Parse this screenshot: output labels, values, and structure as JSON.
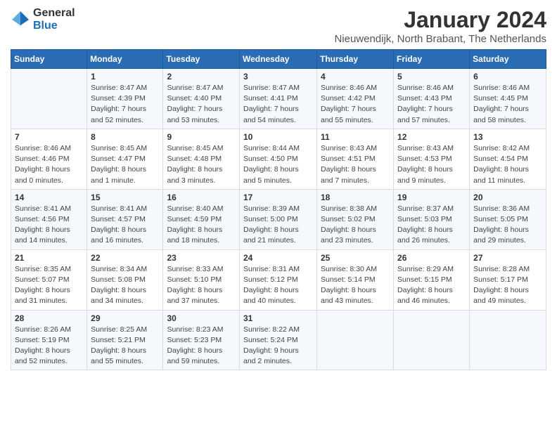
{
  "header": {
    "logo_general": "General",
    "logo_blue": "Blue",
    "title": "January 2024",
    "location": "Nieuwendijk, North Brabant, The Netherlands"
  },
  "weekdays": [
    "Sunday",
    "Monday",
    "Tuesday",
    "Wednesday",
    "Thursday",
    "Friday",
    "Saturday"
  ],
  "weeks": [
    [
      {
        "day": "",
        "info": ""
      },
      {
        "day": "1",
        "info": "Sunrise: 8:47 AM\nSunset: 4:39 PM\nDaylight: 7 hours\nand 52 minutes."
      },
      {
        "day": "2",
        "info": "Sunrise: 8:47 AM\nSunset: 4:40 PM\nDaylight: 7 hours\nand 53 minutes."
      },
      {
        "day": "3",
        "info": "Sunrise: 8:47 AM\nSunset: 4:41 PM\nDaylight: 7 hours\nand 54 minutes."
      },
      {
        "day": "4",
        "info": "Sunrise: 8:46 AM\nSunset: 4:42 PM\nDaylight: 7 hours\nand 55 minutes."
      },
      {
        "day": "5",
        "info": "Sunrise: 8:46 AM\nSunset: 4:43 PM\nDaylight: 7 hours\nand 57 minutes."
      },
      {
        "day": "6",
        "info": "Sunrise: 8:46 AM\nSunset: 4:45 PM\nDaylight: 7 hours\nand 58 minutes."
      }
    ],
    [
      {
        "day": "7",
        "info": "Sunrise: 8:46 AM\nSunset: 4:46 PM\nDaylight: 8 hours\nand 0 minutes."
      },
      {
        "day": "8",
        "info": "Sunrise: 8:45 AM\nSunset: 4:47 PM\nDaylight: 8 hours\nand 1 minute."
      },
      {
        "day": "9",
        "info": "Sunrise: 8:45 AM\nSunset: 4:48 PM\nDaylight: 8 hours\nand 3 minutes."
      },
      {
        "day": "10",
        "info": "Sunrise: 8:44 AM\nSunset: 4:50 PM\nDaylight: 8 hours\nand 5 minutes."
      },
      {
        "day": "11",
        "info": "Sunrise: 8:43 AM\nSunset: 4:51 PM\nDaylight: 8 hours\nand 7 minutes."
      },
      {
        "day": "12",
        "info": "Sunrise: 8:43 AM\nSunset: 4:53 PM\nDaylight: 8 hours\nand 9 minutes."
      },
      {
        "day": "13",
        "info": "Sunrise: 8:42 AM\nSunset: 4:54 PM\nDaylight: 8 hours\nand 11 minutes."
      }
    ],
    [
      {
        "day": "14",
        "info": "Sunrise: 8:41 AM\nSunset: 4:56 PM\nDaylight: 8 hours\nand 14 minutes."
      },
      {
        "day": "15",
        "info": "Sunrise: 8:41 AM\nSunset: 4:57 PM\nDaylight: 8 hours\nand 16 minutes."
      },
      {
        "day": "16",
        "info": "Sunrise: 8:40 AM\nSunset: 4:59 PM\nDaylight: 8 hours\nand 18 minutes."
      },
      {
        "day": "17",
        "info": "Sunrise: 8:39 AM\nSunset: 5:00 PM\nDaylight: 8 hours\nand 21 minutes."
      },
      {
        "day": "18",
        "info": "Sunrise: 8:38 AM\nSunset: 5:02 PM\nDaylight: 8 hours\nand 23 minutes."
      },
      {
        "day": "19",
        "info": "Sunrise: 8:37 AM\nSunset: 5:03 PM\nDaylight: 8 hours\nand 26 minutes."
      },
      {
        "day": "20",
        "info": "Sunrise: 8:36 AM\nSunset: 5:05 PM\nDaylight: 8 hours\nand 29 minutes."
      }
    ],
    [
      {
        "day": "21",
        "info": "Sunrise: 8:35 AM\nSunset: 5:07 PM\nDaylight: 8 hours\nand 31 minutes."
      },
      {
        "day": "22",
        "info": "Sunrise: 8:34 AM\nSunset: 5:08 PM\nDaylight: 8 hours\nand 34 minutes."
      },
      {
        "day": "23",
        "info": "Sunrise: 8:33 AM\nSunset: 5:10 PM\nDaylight: 8 hours\nand 37 minutes."
      },
      {
        "day": "24",
        "info": "Sunrise: 8:31 AM\nSunset: 5:12 PM\nDaylight: 8 hours\nand 40 minutes."
      },
      {
        "day": "25",
        "info": "Sunrise: 8:30 AM\nSunset: 5:14 PM\nDaylight: 8 hours\nand 43 minutes."
      },
      {
        "day": "26",
        "info": "Sunrise: 8:29 AM\nSunset: 5:15 PM\nDaylight: 8 hours\nand 46 minutes."
      },
      {
        "day": "27",
        "info": "Sunrise: 8:28 AM\nSunset: 5:17 PM\nDaylight: 8 hours\nand 49 minutes."
      }
    ],
    [
      {
        "day": "28",
        "info": "Sunrise: 8:26 AM\nSunset: 5:19 PM\nDaylight: 8 hours\nand 52 minutes."
      },
      {
        "day": "29",
        "info": "Sunrise: 8:25 AM\nSunset: 5:21 PM\nDaylight: 8 hours\nand 55 minutes."
      },
      {
        "day": "30",
        "info": "Sunrise: 8:23 AM\nSunset: 5:23 PM\nDaylight: 8 hours\nand 59 minutes."
      },
      {
        "day": "31",
        "info": "Sunrise: 8:22 AM\nSunset: 5:24 PM\nDaylight: 9 hours\nand 2 minutes."
      },
      {
        "day": "",
        "info": ""
      },
      {
        "day": "",
        "info": ""
      },
      {
        "day": "",
        "info": ""
      }
    ]
  ]
}
